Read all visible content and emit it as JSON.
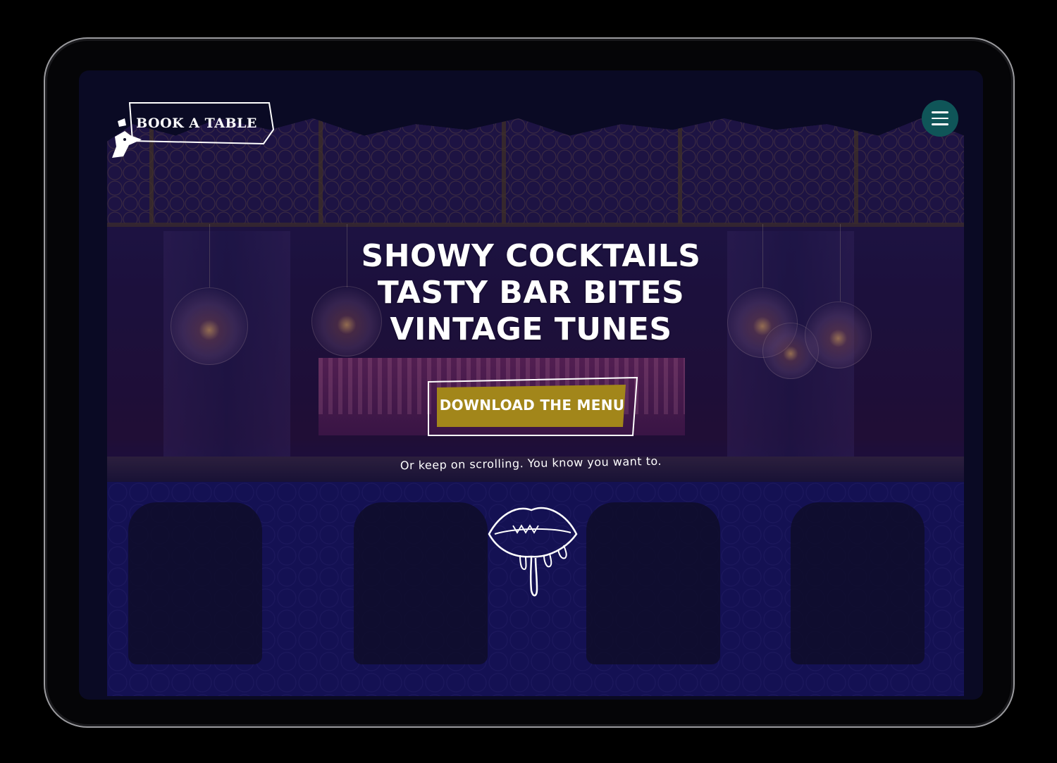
{
  "header": {
    "book_label": "BOOK A TABLE",
    "logo_icon": "bird-head-icon",
    "menu_icon": "hamburger-menu-icon"
  },
  "hero": {
    "lines": [
      "SHOWY COCKTAILS",
      "TASTY BAR BITES",
      "VINTAGE TUNES"
    ],
    "cta_label": "DOWNLOAD THE MENU",
    "scroll_note": "Or keep on scrolling. You know you want to.",
    "scroll_icon": "biting-lips-icon"
  },
  "colors": {
    "page_bg": "#000000",
    "screen_bg": "#0a0a24",
    "cta_bg": "#a2861a",
    "menu_button_bg": "#0f5558",
    "text": "#ffffff"
  }
}
